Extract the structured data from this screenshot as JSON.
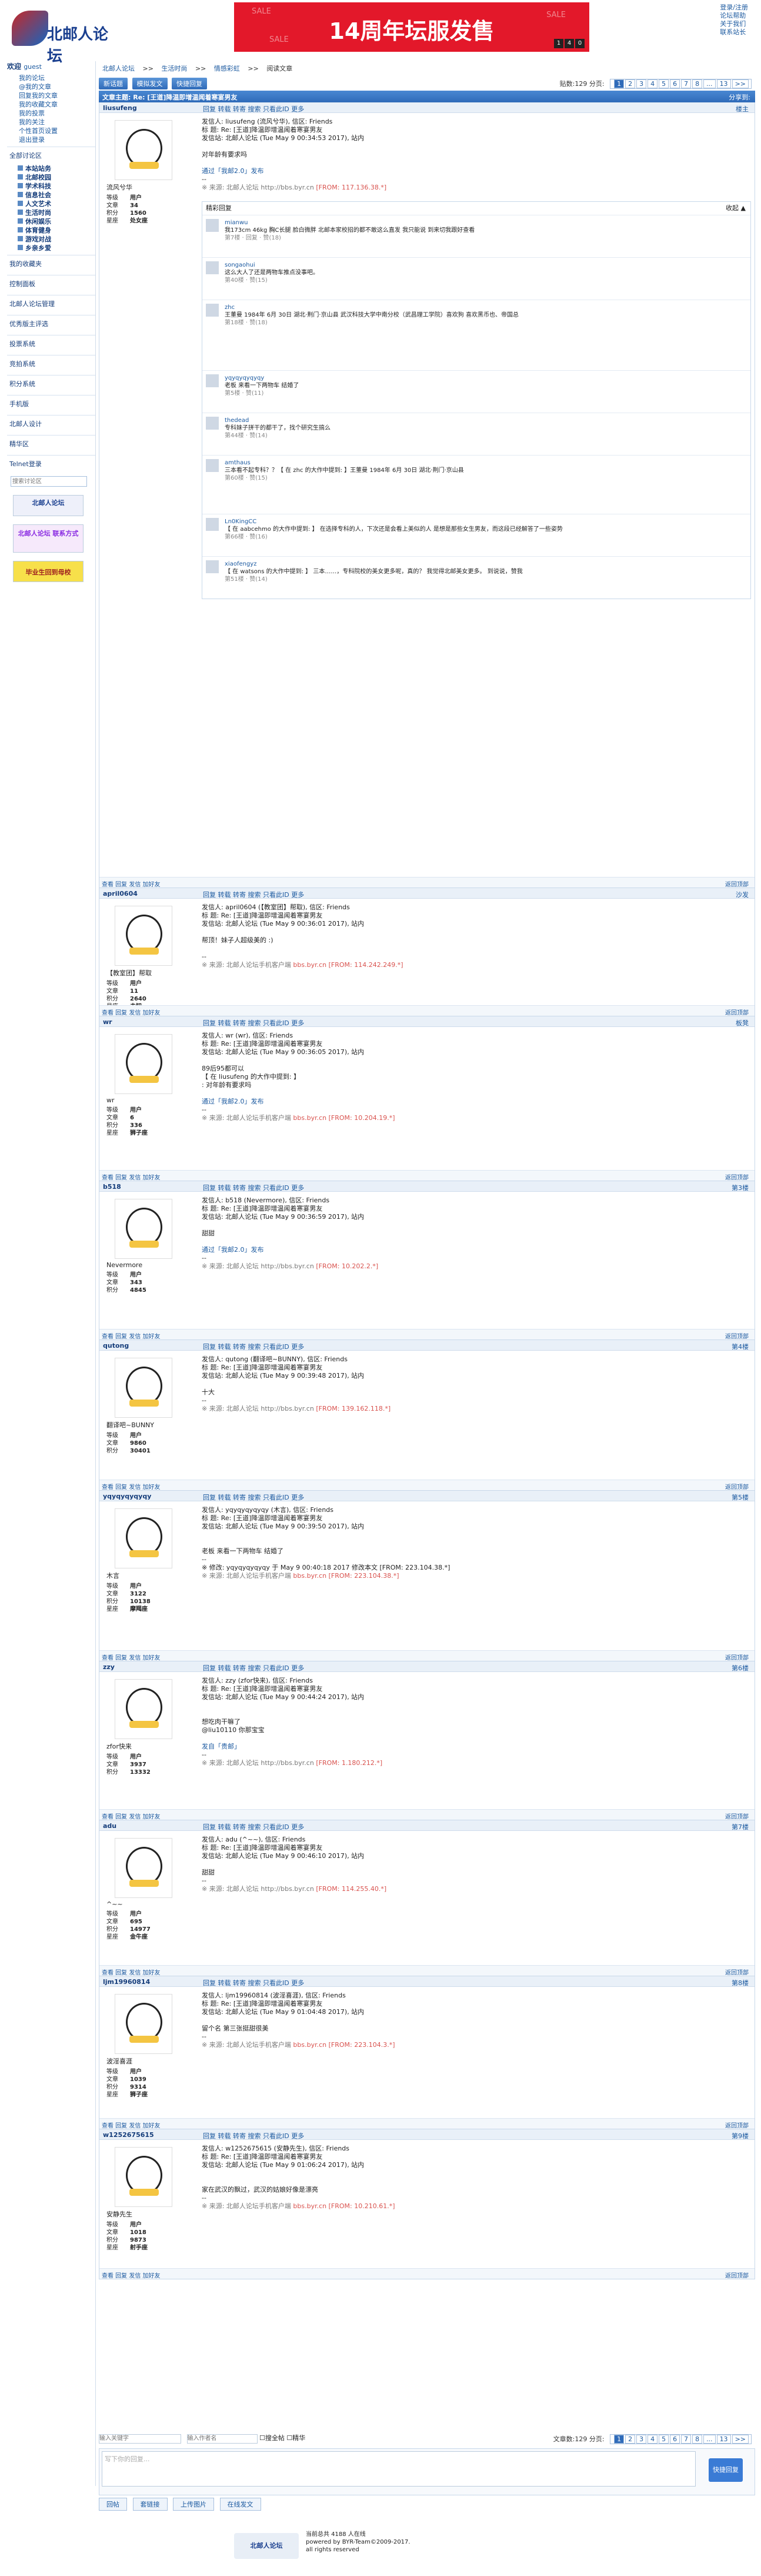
{
  "header": {
    "logo": "北邮人论坛",
    "banner_title": "14周年坛服发售",
    "banner_sale": "SALE",
    "banner_counter": [
      "1",
      "4",
      "0"
    ],
    "toplinks": [
      "登录/注册",
      "论坛帮助",
      "关于我们",
      "联系站长"
    ]
  },
  "sidebar": {
    "welcome": "欢迎",
    "user": "guest",
    "items": [
      "我的论坛",
      "@我的文章",
      "回复我的文章",
      "我的收藏文章",
      "我的投票",
      "我的关注",
      "个性首页设置",
      "退出登录"
    ],
    "all": "全部讨论区",
    "boards": [
      "本站站务",
      "北邮校园",
      "学术科技",
      "信息社会",
      "人文艺术",
      "生活时尚",
      "休闲娱乐",
      "体育健身",
      "游戏对战",
      "乡亲乡爱"
    ],
    "secs": [
      "我的收藏夹",
      "控制面板",
      "北邮人论坛管理",
      "优秀版主评选",
      "投票系统",
      "竞拍系统",
      "积分系统",
      "手机版",
      "北邮人设计",
      "精华区",
      "Telnet登录"
    ],
    "search": "搜索讨论区",
    "ad1": "北邮人论坛",
    "ad2": "北邮人论坛 联系方式",
    "ad3": "毕业生回到母校"
  },
  "crumb": [
    "北邮人论坛",
    ">>",
    "生活时尚",
    ">>",
    "情感彩虹",
    ">>",
    "阅读文章"
  ],
  "buttons": [
    "新话题",
    "模拟发文",
    "快捷回复"
  ],
  "pager": {
    "info": "贴数:129  分页:",
    "pages": [
      "1",
      "2",
      "3",
      "4",
      "5",
      "6",
      "7",
      "8",
      "...",
      "13",
      ">>"
    ],
    "current": "1"
  },
  "thread_title": "文章主题: Re: [王道]降温即增温闻着寒宴男友",
  "thread_right": "分享到:",
  "posts": [
    {
      "name": "liusufeng",
      "floor": "楼主",
      "nick": "流风兮华",
      "stats": [
        [
          "等级",
          "用户"
        ],
        [
          "文章",
          "34"
        ],
        [
          "积分",
          "1560"
        ],
        [
          "星座",
          "处女座"
        ]
      ],
      "lines": [
        "发信人: liusufeng (流风兮华), 信区: Friends",
        "标  题: Re: [王道]降温即增温闻着寒宴男友",
        "发信站: 北邮人论坛 (Tue May  9 00:34:53 2017), 站内",
        "",
        "对年龄有要求吗",
        "",
        "通过「我邮2.0」发布",
        "--"
      ],
      "src": "※ 来源: 北邮人论坛 http://bbs.byr.cn",
      "ip": "[FROM: 117.136.38.*]"
    },
    {
      "name": "april0604",
      "floor": "沙发",
      "nick": "【教室团】帮取",
      "stats": [
        [
          "等级",
          "用户"
        ],
        [
          "文章",
          "11"
        ],
        [
          "积分",
          "2640"
        ],
        [
          "星座",
          "未知"
        ]
      ],
      "lines": [
        "发信人: april0604 (【教室团】帮取), 信区: Friends",
        "标  题: Re: [王道]降温即增温闻着寒宴男友",
        "发信站: 北邮人论坛 (Tue May  9 00:36:01 2017), 站内",
        "",
        "帮顶！妹子人超级美的 :)",
        "",
        "--"
      ],
      "src": "※ 来源: 北邮人论坛手机客户端",
      "ip": "bbs.byr.cn [FROM: 114.242.249.*]"
    },
    {
      "name": "wr",
      "floor": "板凳",
      "nick": "wr",
      "stats": [
        [
          "等级",
          "用户"
        ],
        [
          "文章",
          "6"
        ],
        [
          "积分",
          "336"
        ],
        [
          "星座",
          "狮子座"
        ]
      ],
      "lines": [
        "发信人: wr (wr), 信区: Friends",
        "标  题: Re: [王道]降温即增温闻着寒宴男友",
        "发信站: 北邮人论坛 (Tue May  9 00:36:05 2017), 站内",
        "",
        "89后95都可以",
        "【 在 liusufeng 的大作中提到: 】",
        ": 对年龄有要求吗",
        "",
        "通过「我邮2.0」发布",
        "--"
      ],
      "src": "※ 来源: 北邮人论坛手机客户端",
      "ip": "bbs.byr.cn [FROM: 10.204.19.*]"
    },
    {
      "name": "b518",
      "floor": "第3楼",
      "nick": "Nevermore",
      "stats": [
        [
          "等级",
          "用户"
        ],
        [
          "文章",
          "343"
        ],
        [
          "积分",
          "4845"
        ]
      ],
      "lines": [
        "发信人: b518 (Nevermore), 信区: Friends",
        "标  题: Re: [王道]降温即增温闻着寒宴男友",
        "发信站: 北邮人论坛 (Tue May  9 00:36:59 2017), 站内",
        "",
        "甜甜",
        "",
        "通过「我邮2.0」发布",
        "--"
      ],
      "src": "※ 来源: 北邮人论坛 http://bbs.byr.cn",
      "ip": "[FROM: 10.202.2.*]"
    },
    {
      "name": "qutong",
      "floor": "第4楼",
      "nick": "翻译吧~BUNNY",
      "stats": [
        [
          "等级",
          "用户"
        ],
        [
          "文章",
          "9860"
        ],
        [
          "积分",
          "30401"
        ]
      ],
      "lines": [
        "发信人: qutong (翻译吧~BUNNY), 信区: Friends",
        "标  题: Re: [王道]降温即增温闻着寒宴男友",
        "发信站: 北邮人论坛 (Tue May  9 00:39:48 2017), 站内",
        "",
        "十大",
        "--"
      ],
      "src": "※ 来源: 北邮人论坛 http://bbs.byr.cn",
      "ip": "[FROM: 139.162.118.*]"
    },
    {
      "name": "yqyqyqyqyqy",
      "floor": "第5楼",
      "nick": "木言",
      "stats": [
        [
          "等级",
          "用户"
        ],
        [
          "文章",
          "3122"
        ],
        [
          "积分",
          "10138"
        ],
        [
          "星座",
          "摩羯座"
        ]
      ],
      "lines": [
        "发信人: yqyqyqyqyqy (木言), 信区: Friends",
        "标  题: Re: [王道]降温即增温闻着寒宴男友",
        "发信站: 北邮人论坛 (Tue May  9 00:39:50 2017), 站内",
        "",
        "",
        "老板 来看一下两物车 结婚了",
        "--",
        "※ 修改: yqyqyqyqyqy 于 May  9 00:40:18 2017 修改本文 [FROM: 223.104.38.*]"
      ],
      "src": "※ 来源: 北邮人论坛手机客户端",
      "ip": "bbs.byr.cn [FROM: 223.104.38.*]"
    },
    {
      "name": "zzy",
      "floor": "第6楼",
      "nick": "zfor快来",
      "stats": [
        [
          "等级",
          "用户"
        ],
        [
          "文章",
          "3937"
        ],
        [
          "积分",
          "13332"
        ]
      ],
      "lines": [
        "发信人: zzy (zfor快来), 信区: Friends",
        "标  题: Re: [王道]降温即增温闻着寒宴男友",
        "发信站: 北邮人论坛 (Tue May  9 00:44:24 2017), 站内",
        "",
        "",
        "想吃肉干嘛了",
        "@liu10110 你那宝宝",
        "",
        "发自「贵邮」",
        "--"
      ],
      "src": "※ 来源: 北邮人论坛 http://bbs.byr.cn",
      "ip": "[FROM: 1.180.212.*]"
    },
    {
      "name": "adu",
      "floor": "第7楼",
      "nick": "^~~",
      "stats": [
        [
          "等级",
          "用户"
        ],
        [
          "文章",
          "695"
        ],
        [
          "积分",
          "14977"
        ],
        [
          "星座",
          "金牛座"
        ]
      ],
      "lines": [
        "发信人: adu (^~~), 信区: Friends",
        "标  题: Re: [王道]降温即增温闻着寒宴男友",
        "发信站: 北邮人论坛 (Tue May  9 00:46:10 2017), 站内",
        "",
        "甜甜",
        "--"
      ],
      "src": "※ 来源: 北邮人论坛 http://bbs.byr.cn",
      "ip": "[FROM: 114.255.40.*]"
    },
    {
      "name": "ljm19960814",
      "floor": "第8楼",
      "nick": "波淫喜涯",
      "stats": [
        [
          "等级",
          "用户"
        ],
        [
          "文章",
          "1039"
        ],
        [
          "积分",
          "9314"
        ],
        [
          "星座",
          "狮子座"
        ]
      ],
      "lines": [
        "发信人: ljm19960814 (波淫喜涯), 信区: Friends",
        "标  题: Re: [王道]降温即增温闻着寒宴男友",
        "发信站: 北邮人论坛 (Tue May  9 01:04:48 2017), 站内",
        "",
        "留个名 第三张挺甜很美",
        "--"
      ],
      "src": "※ 来源: 北邮人论坛手机客户端",
      "ip": "bbs.byr.cn [FROM: 223.104.3.*]"
    },
    {
      "name": "w1252675615",
      "floor": "第9楼",
      "nick": "安静先生",
      "stats": [
        [
          "等级",
          "用户"
        ],
        [
          "文章",
          "1018"
        ],
        [
          "积分",
          "9873"
        ],
        [
          "星座",
          "射手座"
        ]
      ],
      "lines": [
        "发信人: w1252675615 (安静先生), 信区: Friends",
        "标  题: Re: [王道]降温即增温闻着寒宴男友",
        "发信站: 北邮人论坛 (Tue May  9 01:06:24 2017), 站内",
        "",
        "",
        "家在武汉的飘过，武汉的姑娘好像是漂亮",
        "--"
      ],
      "src": "※ 来源: 北邮人论坛手机客户端",
      "ip": "bbs.byr.cn [FROM: 10.210.61.*]"
    }
  ],
  "post_foot": {
    "left": "查看  回复  发信  加好友",
    "right": "返回顶部"
  },
  "post_tools": "回复  转载  转寄  搜索  只看此ID  更多",
  "hot_title": "精彩回复",
  "hot_toggle": "收起 ▲",
  "hot": [
    {
      "u": "mianwu",
      "t": "我173cm 46kg 胸C长腿 脸白微胖 北邮本家校招的都不敢这么直发 我只能说 到来切我跟好查看",
      "m": "第7楼 · 回复 · 赞(18)"
    },
    {
      "u": "songaohui",
      "t": "这么大人了还是两物车推点没事吧。",
      "m": "第40楼 · 赞(15)"
    },
    {
      "u": "zhc",
      "t": "王董曼 1984年 6月 30日 湖北·荆门·京山县 武汉科技大学中南分校（武昌理工学院）喜欢狗 喜欢黑币也、帝国总",
      "m": "第18楼 · 赞(18)"
    },
    {
      "u": "yqyqyqyqyqy",
      "t": "老板 来看一下两物车 结婚了",
      "m": "第5楼 · 赞(11)"
    },
    {
      "u": "thedead",
      "t": "专科妹子拼干的都干了，找个研究生搞么",
      "m": "第44楼 · 赞(14)"
    },
    {
      "u": "amthaus",
      "t": "三本看不起专科？？【 在 zhc 的大作中提到: 】王董曼 1984年 6月 30日 湖北·荆门·京山县",
      "m": "第60楼 · 赞(15)"
    },
    {
      "u": "Ln0KingCC",
      "t": "【 在 aabcehmo 的大作中提到: 】 在选择专科的人，下次还是会看上美似的人 是想是那些女生男友，而这段已经解答了一些姿势",
      "m": "第66楼 · 赞(16)"
    },
    {
      "u": "xiaofengyz",
      "t": "【 在 watsons 的大作中提到: 】 三本……，专科院校的美女更多呢，真的？ 我觉得北邮美女更多。 到说说，赞我",
      "m": "第51楼 · 赞(14)"
    }
  ],
  "bottom": {
    "search_ph": "输入关键字",
    "author_ph": "输入作者名",
    "check1": "搜全帖",
    "check2": "精华",
    "pager_info": "文章数:129  分页:",
    "reply_ph": "写下你的回复...",
    "reply_btn": "快捷回复",
    "tabs": [
      "回帖",
      "套链接",
      "上传图片",
      "在线发文"
    ]
  },
  "footer": {
    "logo": "北邮人论坛",
    "l1": "当前总共 4188 人在线",
    "l2": "powered by BYR-Team©2009-2017.",
    "l3": "all rights reserved"
  }
}
